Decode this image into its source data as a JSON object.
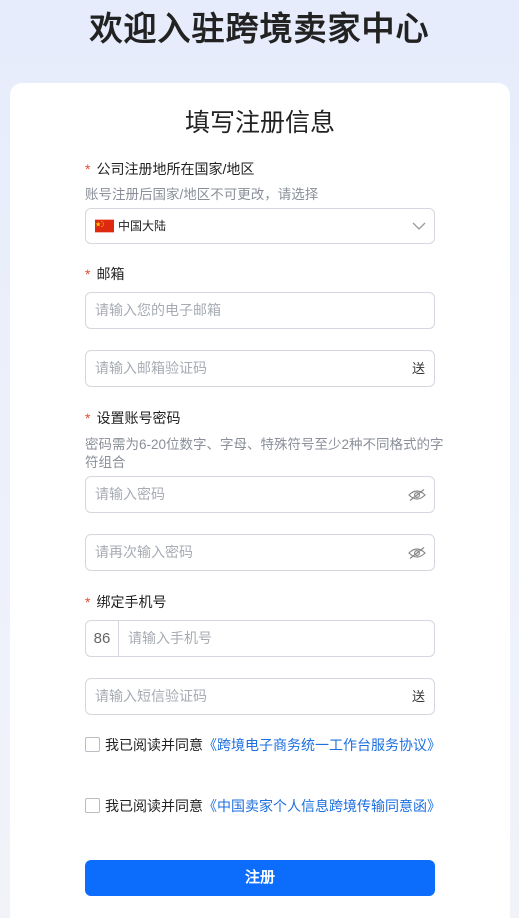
{
  "page": {
    "title": "欢迎入驻跨境卖家中心"
  },
  "form": {
    "title": "填写注册信息",
    "required_mark": "*",
    "country": {
      "label": "公司注册地所在国家/地区",
      "hint": "账号注册后国家/地区不可更改，请选择",
      "value": "中国大陆",
      "flag_icon": "china-flag-icon"
    },
    "email": {
      "label": "邮箱",
      "placeholder": "请输入您的电子邮箱",
      "code_placeholder": "请输入邮箱验证码",
      "send_label": "送"
    },
    "password": {
      "label": "设置账号密码",
      "hint": "密码需为6-20位数字、字母、特殊符号至少2种不同格式的字符组合",
      "placeholder": "请输入密码",
      "confirm_placeholder": "请再次输入密码"
    },
    "phone": {
      "label": "绑定手机号",
      "prefix": "86",
      "placeholder": "请输入手机号",
      "code_placeholder": "请输入短信验证码",
      "send_label": "送"
    },
    "agreements": [
      {
        "prefix": "我已阅读并同意",
        "link": "《跨境电子商务统一工作台服务协议》"
      },
      {
        "prefix": "我已阅读并同意",
        "link": "《中国卖家个人信息跨境传输同意函》"
      }
    ],
    "submit_label": "注册"
  },
  "colors": {
    "accent": "#0c6dfd",
    "link": "#1d6fe0",
    "required": "#e54d2e"
  }
}
